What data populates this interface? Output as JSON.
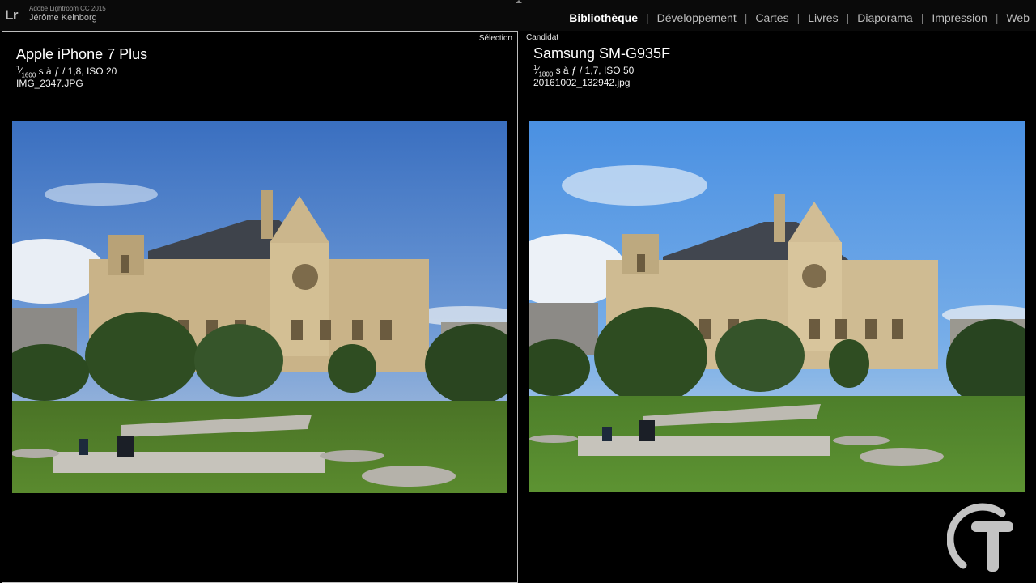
{
  "app": {
    "logo": "Lr",
    "title": "Adobe Lightroom CC 2015",
    "user": "Jérôme Keinborg"
  },
  "modules": [
    {
      "label": "Bibliothèque",
      "active": true
    },
    {
      "label": "Développement",
      "active": false
    },
    {
      "label": "Cartes",
      "active": false
    },
    {
      "label": "Livres",
      "active": false
    },
    {
      "label": "Diaporama",
      "active": false
    },
    {
      "label": "Impression",
      "active": false
    },
    {
      "label": "Web",
      "active": false
    }
  ],
  "selection": {
    "label": "Sélection",
    "camera": "Apple iPhone 7 Plus",
    "shutter_num": "1",
    "shutter_den": "1600",
    "exposure_rest": " s à ƒ / 1,8, ISO 20",
    "filename": "IMG_2347.JPG"
  },
  "candidate": {
    "label": "Candidat",
    "camera": "Samsung SM-G935F",
    "shutter_num": "1",
    "shutter_den": "1800",
    "exposure_rest": " s à ƒ / 1,7, ISO 50",
    "filename": "20161002_132942.jpg"
  },
  "colors": {
    "sky_left": "#3f78c8",
    "sky_right": "#4d92e0",
    "stone": "#cdb88d",
    "roof": "#3e434b",
    "grass": "#4d7a2a",
    "trees": "#2f4d22",
    "accent_active": "#ffffff"
  },
  "icons": {
    "watermark": "t-logo-watermark",
    "collapse": "triangle-up-icon"
  }
}
